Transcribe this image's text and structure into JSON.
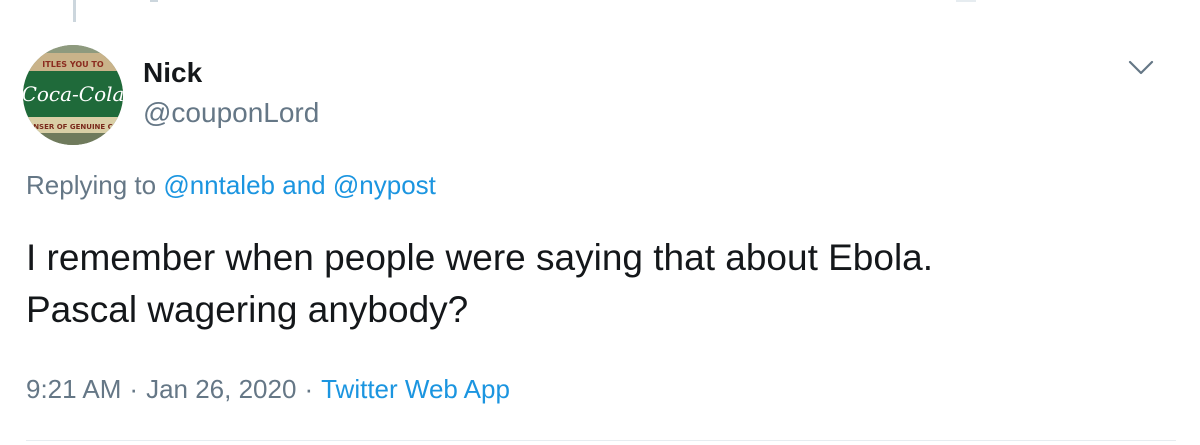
{
  "tweet": {
    "author": {
      "display_name": "Nick",
      "handle": "@couponLord",
      "avatar": {
        "icon": "coca-cola-sign-avatar",
        "logo_text": "Coca-Cola",
        "top_text": "ITLES YOU TO",
        "bottom_text": "NSER OF GENUINE C"
      }
    },
    "replying": {
      "prefix": "Replying to",
      "mention_1": "@nntaleb",
      "conjunction": "and",
      "mention_2": "@nypost"
    },
    "text_lines": [
      "I remember when people were saying that about Ebola.",
      "Pascal wagering anybody?"
    ],
    "time": "9:21 AM",
    "separator": "·",
    "date": "Jan 26, 2020",
    "source": "Twitter Web App",
    "menu_icon": "chevron-down-icon"
  },
  "colors": {
    "text_primary": "#14171a",
    "text_secondary": "#657786",
    "link": "#1b95e0",
    "divider": "#e6ecf0"
  }
}
